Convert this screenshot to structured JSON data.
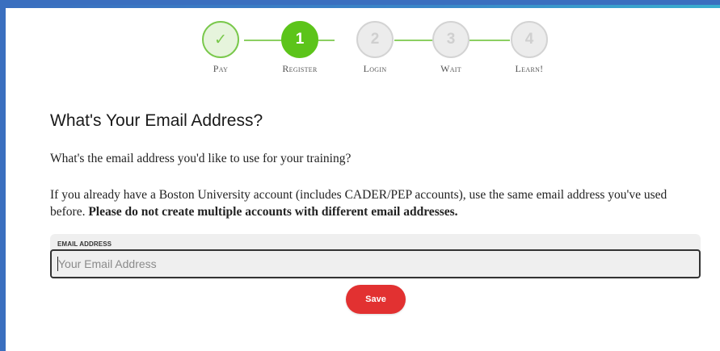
{
  "colors": {
    "frame_blue": "#3a6fbf",
    "step_done": "#79c84b",
    "step_active": "#5cc41a",
    "step_pending": "#d3d3d3",
    "save_red": "#e23131"
  },
  "stepper": {
    "steps": [
      {
        "label": "Pay",
        "marker": "✓",
        "state": "done",
        "icon": "check-icon"
      },
      {
        "label": "Register",
        "marker": "1",
        "state": "active"
      },
      {
        "label": "Login",
        "marker": "2",
        "state": "pending"
      },
      {
        "label": "Wait",
        "marker": "3",
        "state": "pending"
      },
      {
        "label": "Learn!",
        "marker": "4",
        "state": "pending"
      }
    ]
  },
  "main": {
    "heading": "What's Your Email Address?",
    "intro": "What's the email address you'd like to use for your training?",
    "notice_text": "If you already have a Boston University account (includes CADER/PEP accounts), use the same email address you've used before. ",
    "notice_bold": "Please do not create multiple accounts with different email addresses."
  },
  "form": {
    "email_label": "EMAIL ADDRESS",
    "email_placeholder": "Your Email Address",
    "email_value": "",
    "save_label": "Save"
  }
}
